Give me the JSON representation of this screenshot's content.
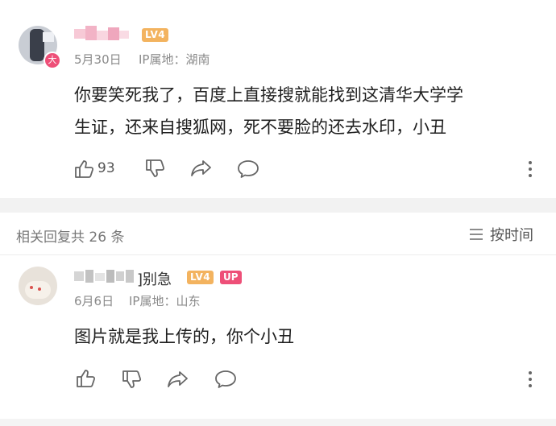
{
  "comment1": {
    "date": "5月30日",
    "ip_location": "IP属地：湖南",
    "level": "LV4",
    "text_line1": "你要笑死我了，百度上直接搜就能找到这清华大学学",
    "text_line2": "生证，还来自搜狐网，死不要脸的还去水印，小丑",
    "like_count": "93"
  },
  "replies_header": {
    "count_label": "相关回复共 26 条",
    "sort_label": "按时间"
  },
  "reply1": {
    "username_suffix": "]别急",
    "level": "LV4",
    "up_badge": "UP",
    "date": "6月6日",
    "ip_location": "IP属地：山东",
    "text": "图片就是我上传的，你个小丑"
  },
  "colors": {
    "level_badge": "#f3b35f",
    "up_badge": "#ee4f78",
    "divider_band": "#f2f2f2"
  }
}
